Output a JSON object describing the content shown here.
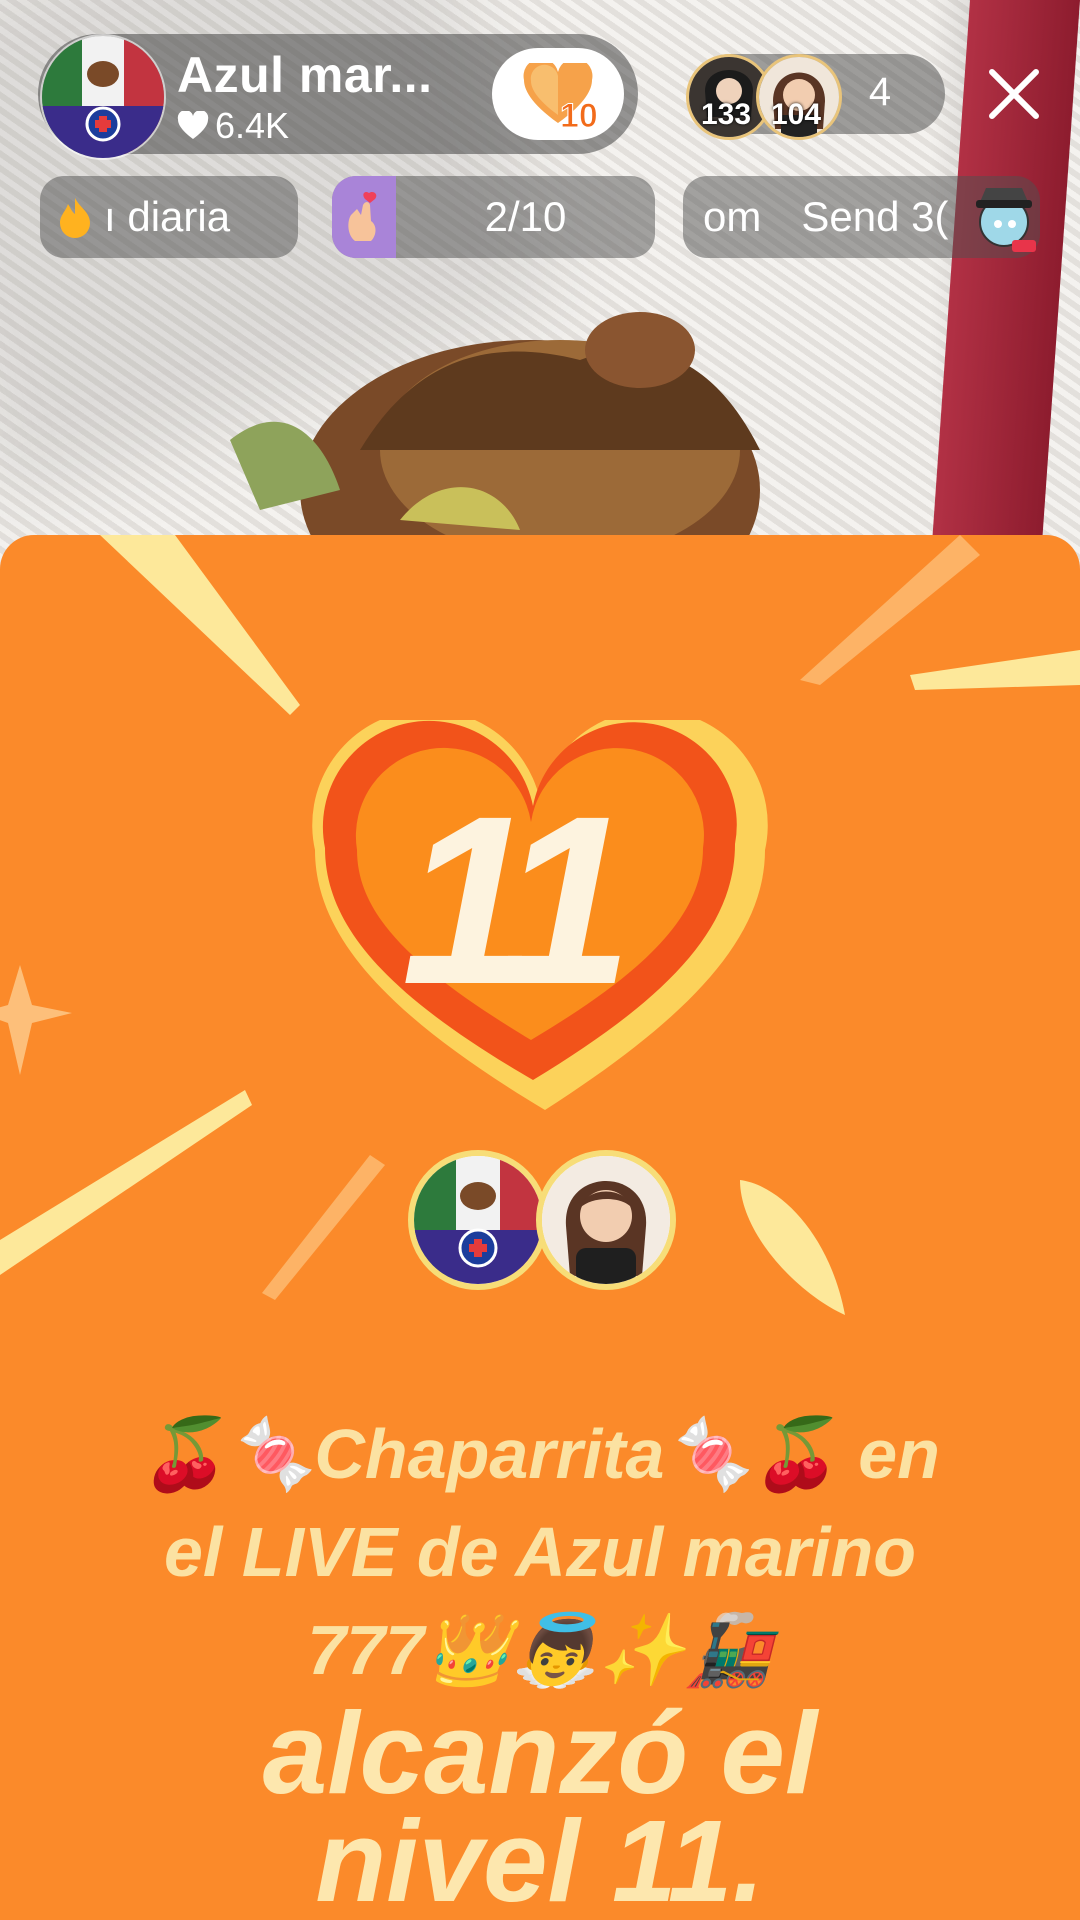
{
  "host": {
    "name": "Azul mar...",
    "likes": "6.4K",
    "fan_level": "10"
  },
  "viewers": {
    "top": [
      {
        "score": "133"
      },
      {
        "score": "104"
      }
    ],
    "count": "4"
  },
  "tasks": {
    "daily_label": "ı diaria",
    "progress": "2/10",
    "send_text_left": "om",
    "send_text": "Send 3("
  },
  "levelup": {
    "level": "11",
    "line1": "🍒🍬Chaparrita🍬🍒 en",
    "line2": "el LIVE de Azul marino",
    "line3": "777👑👼✨🚂",
    "line4": "alcanzó el",
    "line5": "nivel 11."
  },
  "colors": {
    "card_orange": "#fb8a2a",
    "heart_red": "#f2531a",
    "heart_yellow": "#fcd25a",
    "text_cream": "#fbe2a2"
  },
  "icons": [
    "heart-icon",
    "fan-heart-icon",
    "close-icon",
    "fire-icon",
    "finger-heart-icon",
    "send-gift-icon",
    "level-heart-icon"
  ]
}
